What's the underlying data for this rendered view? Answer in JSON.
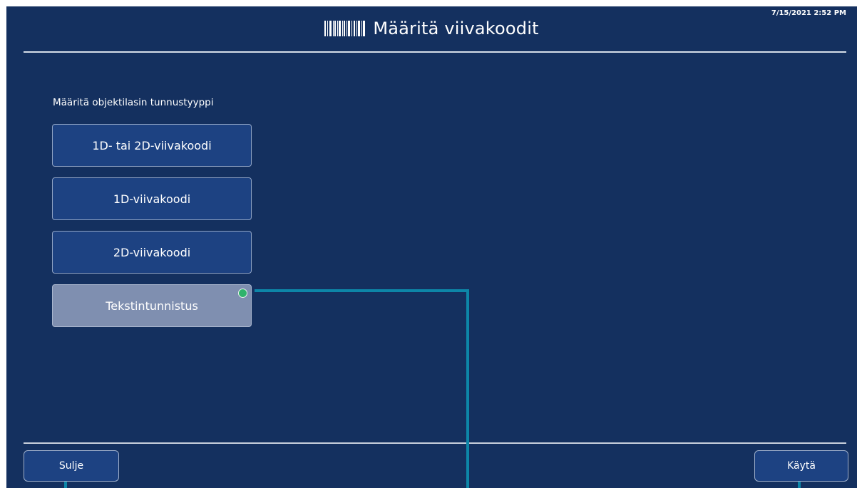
{
  "header": {
    "title": "Määritä viivakoodit",
    "icon": "barcode-icon",
    "timestamp": "7/15/2021 2:52 PM"
  },
  "section": {
    "label": "Määritä objektilasin tunnustyyppi"
  },
  "options": [
    {
      "label": "1D- tai 2D-viivakoodi",
      "selected": false
    },
    {
      "label": "1D-viivakoodi",
      "selected": false
    },
    {
      "label": "2D-viivakoodi",
      "selected": false
    },
    {
      "label": "Tekstintunnistus",
      "selected": true
    }
  ],
  "footer": {
    "close_label": "Sulje",
    "apply_label": "Käytä"
  },
  "colors": {
    "background": "#14305f",
    "button": "#1d4282",
    "selected": "#7f8fb0",
    "check": "#2fb36b",
    "callout": "#0d86a8"
  }
}
